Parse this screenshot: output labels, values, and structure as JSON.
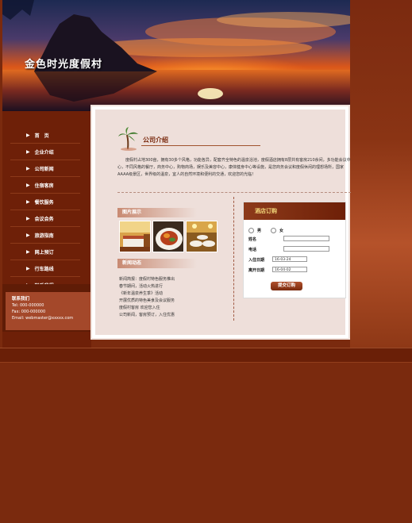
{
  "site": {
    "title": "金色时光度假村"
  },
  "nav": {
    "items": [
      {
        "label": "首　页"
      },
      {
        "label": "企业介绍"
      },
      {
        "label": "公司新闻"
      },
      {
        "label": "住宿客房"
      },
      {
        "label": "餐饮服务"
      },
      {
        "label": "会议会务"
      },
      {
        "label": "旅游指南"
      },
      {
        "label": "网上预订"
      },
      {
        "label": "行车路线"
      },
      {
        "label": "联系我们"
      }
    ]
  },
  "contact": {
    "title": "联系我们",
    "tel": "Tel: 000-000000",
    "fax": "Fax: 000-000000",
    "email": "Email: webmaster@xxxxx.com"
  },
  "about": {
    "title": "公司介绍",
    "text": "度假村占地300亩，拥有30多个风格，功能各异，配套齐全特色的温泉浴池，度假酒店拥有8层共有客房210余间，多功能会议中心，不同风格的餐厅，商务中心，购物商场，娱乐及美容中心，康体健身中心等设施，是您商务会议和度假休闲的理想场所，国家AAAA级景区，世界级的温泉，宜人的自然环境和便利的交通，欢迎您的光临！"
  },
  "sections": {
    "facilities_label": "图片展示",
    "news_label": "新闻动态"
  },
  "news": {
    "items": [
      "新闻简报：度假村特色服务推出",
      "春节期间，活动火热进行",
      "《新年温泉养生季》活动",
      "开展优质的特色美食及会议服务",
      "度假村客房 欢迎您入住",
      "公司新闻，客房预订，入住优惠"
    ]
  },
  "booking": {
    "title": "酒店订购",
    "gender_male": "男",
    "gender_female": "女",
    "name_label": "姓名",
    "phone_label": "电话",
    "checkin_label": "入住日期",
    "checkin_value": "16-03-24",
    "checkout_label": "离开日期",
    "checkout_value": "16-04-02",
    "submit_label": "提交订购"
  },
  "colors": {
    "page_bg": "#7a2a0e",
    "accent": "#8d3a1a",
    "card_bg": "#eedfda"
  }
}
